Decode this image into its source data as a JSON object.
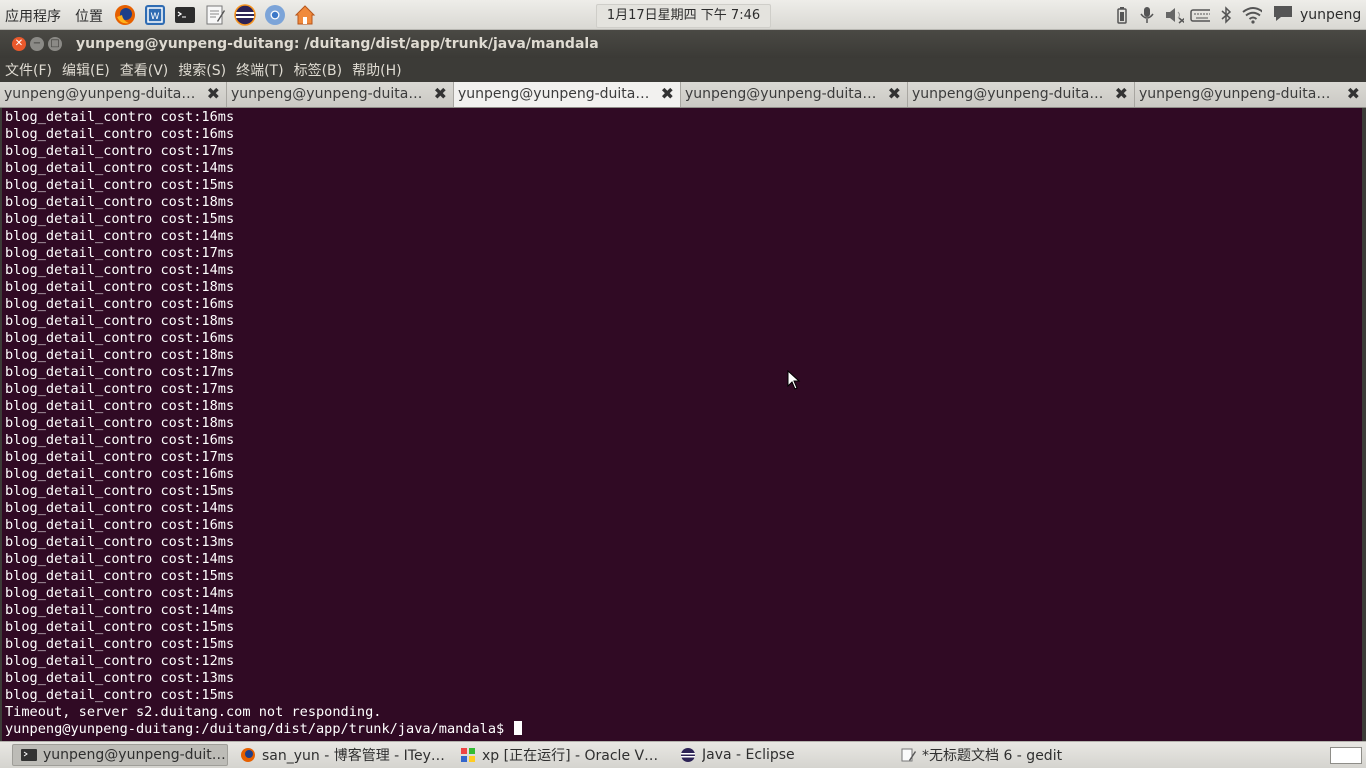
{
  "top_panel": {
    "applications_label": "应用程序",
    "places_label": "位置",
    "launchers": [
      "firefox-icon",
      "vmware-icon",
      "terminal-icon",
      "text-editor-icon",
      "eclipse-icon",
      "chrome-icon",
      "home-folder-icon"
    ],
    "clock": "1月17日星期四 下午 7:46",
    "tray_icons": [
      "battery-icon",
      "microphone-icon",
      "volume-muted-icon",
      "keyboard-icon",
      "bluetooth-icon",
      "wifi-icon"
    ],
    "user_name": "yunpeng"
  },
  "window": {
    "title": "yunpeng@yunpeng-duitang: /duitang/dist/app/trunk/java/mandala"
  },
  "menubar": [
    {
      "label": "文件(F)"
    },
    {
      "label": "编辑(E)"
    },
    {
      "label": "查看(V)"
    },
    {
      "label": "搜索(S)"
    },
    {
      "label": "终端(T)"
    },
    {
      "label": "标签(B)"
    },
    {
      "label": "帮助(H)"
    }
  ],
  "tabs": [
    {
      "label": "yunpeng@yunpeng-duitang: /duitang/dist/app/trunk/java/mandala",
      "active": false
    },
    {
      "label": "yunpeng@yunpeng-duitang: /duitang/dist/app/trunk/java/mandala",
      "active": false
    },
    {
      "label": "yunpeng@yunpeng-duitang: /duitang/dist/app/trunk/java/mandala",
      "active": true
    },
    {
      "label": "yunpeng@yunpeng-duitang: /duitang/dist/app/trunk/java/mandala",
      "active": false
    },
    {
      "label": "yunpeng@yunpeng-duitang: /duitang/dist/app/trunk/java/mandala",
      "active": false
    },
    {
      "label": "yunpeng@yunpeng-duitang: /duitang/dist/app/trunk/java/mandala",
      "active": false
    }
  ],
  "terminal": {
    "lines": [
      "blog_detail_contro cost:16ms",
      "blog_detail_contro cost:16ms",
      "blog_detail_contro cost:17ms",
      "blog_detail_contro cost:14ms",
      "blog_detail_contro cost:15ms",
      "blog_detail_contro cost:18ms",
      "blog_detail_contro cost:15ms",
      "blog_detail_contro cost:14ms",
      "blog_detail_contro cost:17ms",
      "blog_detail_contro cost:14ms",
      "blog_detail_contro cost:18ms",
      "blog_detail_contro cost:16ms",
      "blog_detail_contro cost:18ms",
      "blog_detail_contro cost:16ms",
      "blog_detail_contro cost:18ms",
      "blog_detail_contro cost:17ms",
      "blog_detail_contro cost:17ms",
      "blog_detail_contro cost:18ms",
      "blog_detail_contro cost:18ms",
      "blog_detail_contro cost:16ms",
      "blog_detail_contro cost:17ms",
      "blog_detail_contro cost:16ms",
      "blog_detail_contro cost:15ms",
      "blog_detail_contro cost:14ms",
      "blog_detail_contro cost:16ms",
      "blog_detail_contro cost:13ms",
      "blog_detail_contro cost:14ms",
      "blog_detail_contro cost:15ms",
      "blog_detail_contro cost:14ms",
      "blog_detail_contro cost:14ms",
      "blog_detail_contro cost:15ms",
      "blog_detail_contro cost:15ms",
      "blog_detail_contro cost:12ms",
      "blog_detail_contro cost:13ms",
      "blog_detail_contro cost:15ms",
      "Timeout, server s2.duitang.com not responding."
    ],
    "prompt": "yunpeng@yunpeng-duitang:/duitang/dist/app/trunk/java/mandala$ "
  },
  "taskbar": [
    {
      "label": "yunpeng@yunpeng-duitang: /duitang/dist/app/trunk/java/mandala",
      "icon": "terminal-icon",
      "active": true
    },
    {
      "label": "san_yun - 博客管理 - ITeye技术网站 - Mozilla Firefox",
      "icon": "firefox-icon",
      "active": false
    },
    {
      "label": "xp [正在运行] - Oracle VM VirtualBox",
      "icon": "virtualbox-icon",
      "active": false
    },
    {
      "label": "Java - Eclipse",
      "icon": "eclipse-icon",
      "active": false
    },
    {
      "label": "*无标题文档 6 - gedit",
      "icon": "gedit-icon",
      "active": false
    }
  ],
  "colors": {
    "terminal_bg": "#300a24",
    "terminal_fg": "#ffffff",
    "close_button": "#e9592c"
  }
}
